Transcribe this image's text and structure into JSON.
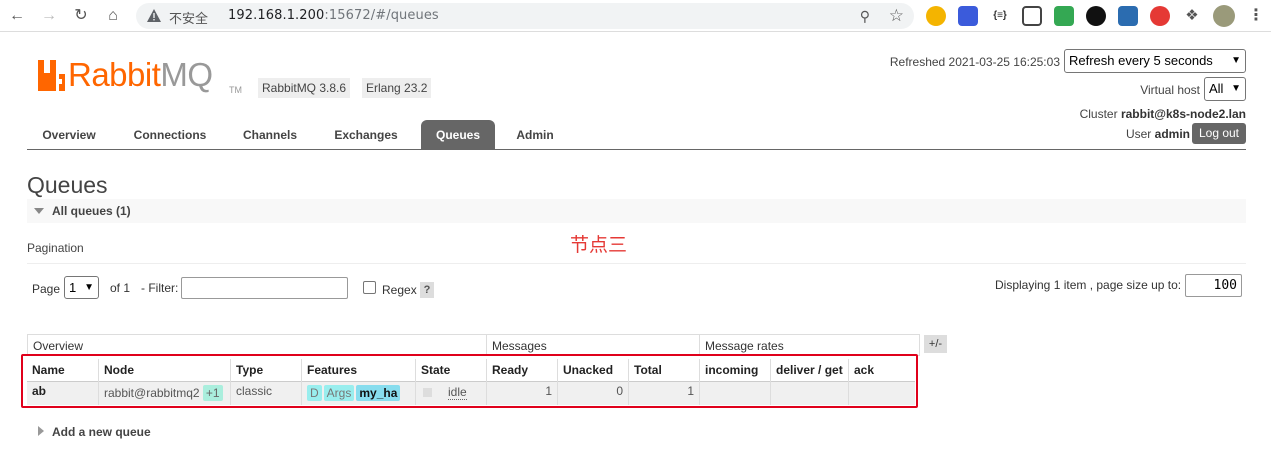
{
  "browser": {
    "insecure_label": "不安全",
    "url_host": "192.168.1.200",
    "url_rest": ":15672/#/queues"
  },
  "header": {
    "logo_rabbit": "Rabbit",
    "logo_mq": "MQ",
    "logo_tm": "TM",
    "rabbitmq_version": "RabbitMQ 3.8.6",
    "erlang_version": "Erlang 23.2",
    "refreshed": "Refreshed 2021-03-25 16:25:03",
    "refresh_select": "Refresh every 5 seconds",
    "vhost_label": "Virtual host",
    "vhost_select": "All",
    "cluster_label": "Cluster",
    "cluster_name": "rabbit@k8s-node2.lan",
    "user_label": "User",
    "user_name": "admin",
    "logout": "Log out"
  },
  "tabs": [
    "Overview",
    "Connections",
    "Channels",
    "Exchanges",
    "Queues",
    "Admin"
  ],
  "active_tab": "Queues",
  "page": {
    "title": "Queues",
    "section": "All queues (1)",
    "pagination_label": "Pagination",
    "annotation": "节点三"
  },
  "pagination": {
    "page_label": "Page",
    "page_value": "1",
    "of_label": "of 1",
    "filter_label": "- Filter:",
    "regex_label": "Regex",
    "help": "?",
    "display_label": "Displaying 1 item , page size up to:",
    "page_size": "100"
  },
  "table": {
    "groups": [
      "Overview",
      "Messages",
      "Message rates"
    ],
    "toggle": "+/-",
    "headers": [
      "Name",
      "Node",
      "Type",
      "Features",
      "State",
      "Ready",
      "Unacked",
      "Total",
      "incoming",
      "deliver / get",
      "ack"
    ],
    "rows": [
      {
        "name": "ab",
        "node": "rabbit@rabbitmq2",
        "node_extra": "+1",
        "type": "classic",
        "features": [
          "D",
          "Args",
          "my_ha"
        ],
        "state": "idle",
        "ready": "1",
        "unacked": "0",
        "total": "1",
        "incoming": "",
        "deliver_get": "",
        "ack": ""
      }
    ]
  },
  "add_queue": "Add a new queue"
}
